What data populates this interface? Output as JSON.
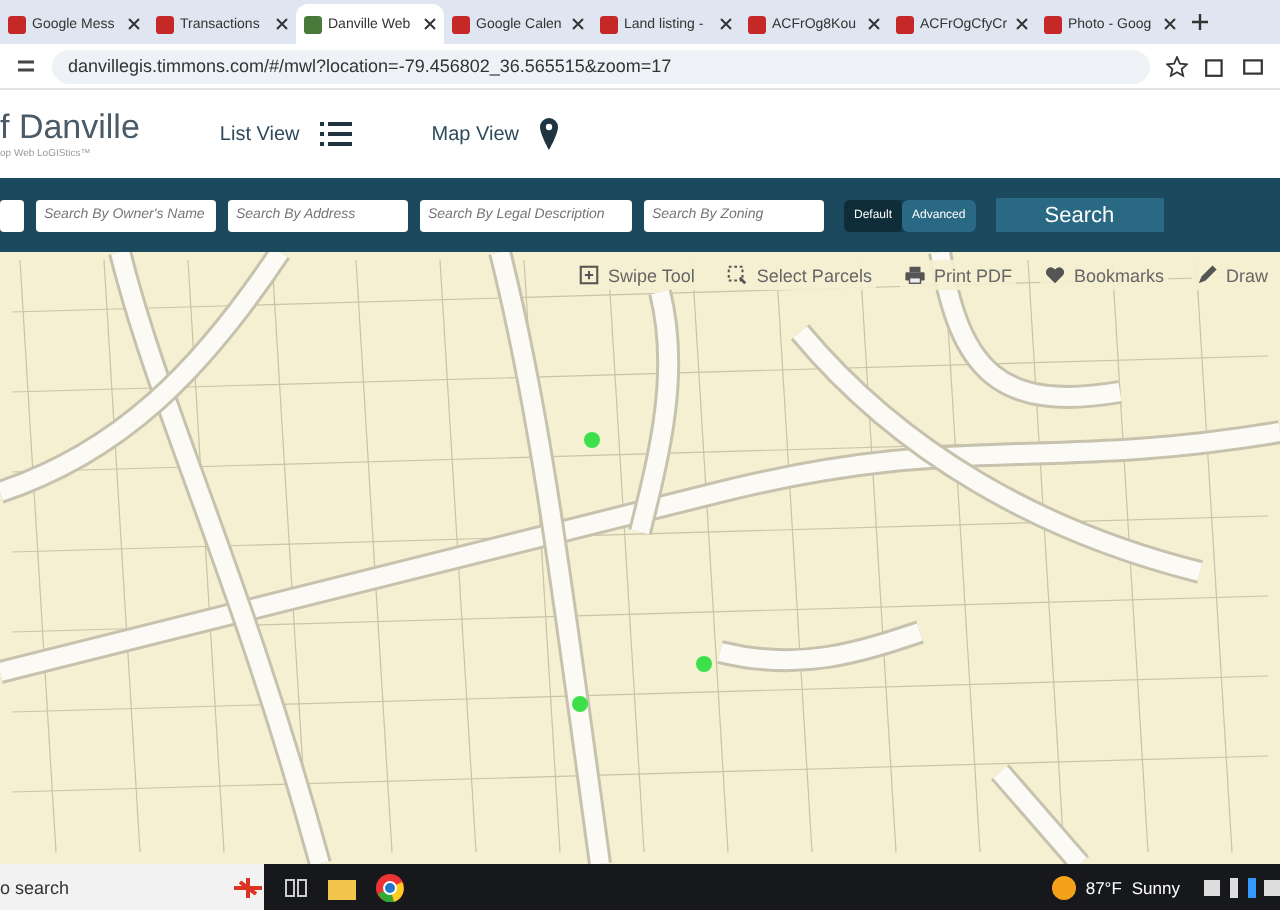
{
  "browser": {
    "tabs": [
      {
        "title": "Google Mess",
        "selected": false
      },
      {
        "title": "Transactions",
        "selected": false
      },
      {
        "title": "Danville Web",
        "selected": true
      },
      {
        "title": "Google Calen",
        "selected": false
      },
      {
        "title": "Land listing -",
        "selected": false
      },
      {
        "title": "ACFrOg8Kou",
        "selected": false
      },
      {
        "title": "ACFrOgCfyCr",
        "selected": false
      },
      {
        "title": "Photo - Goog",
        "selected": false
      }
    ],
    "url": "danvillegis.timmons.com/#/mwl?location=-79.456802_36.565515&zoom=17"
  },
  "header": {
    "title": "f Danville",
    "subtitle": "op Web LoGIStics™",
    "nav": [
      {
        "label": "List View",
        "kind": "list"
      },
      {
        "label": "Map View",
        "kind": "pin"
      }
    ]
  },
  "search_bar": {
    "fields": [
      {
        "placeholder": "Search By Owner's Name"
      },
      {
        "placeholder": "Search By Address"
      },
      {
        "placeholder": "Search By Legal Description"
      },
      {
        "placeholder": "Search By Zoning"
      }
    ],
    "modes": [
      {
        "label": "Default",
        "selected": true
      },
      {
        "label": "Advanced",
        "selected": false
      }
    ],
    "button": "Search"
  },
  "map_tools": [
    {
      "label": "Swipe Tool",
      "kind": "swipe"
    },
    {
      "label": "Select Parcels",
      "kind": "select"
    },
    {
      "label": "Print PDF",
      "kind": "print"
    },
    {
      "label": "Bookmarks",
      "kind": "heart"
    },
    {
      "label": "Draw",
      "kind": "pencil"
    }
  ],
  "taskbar": {
    "search": "o search",
    "weather": "87°F",
    "condition": "Sunny"
  }
}
